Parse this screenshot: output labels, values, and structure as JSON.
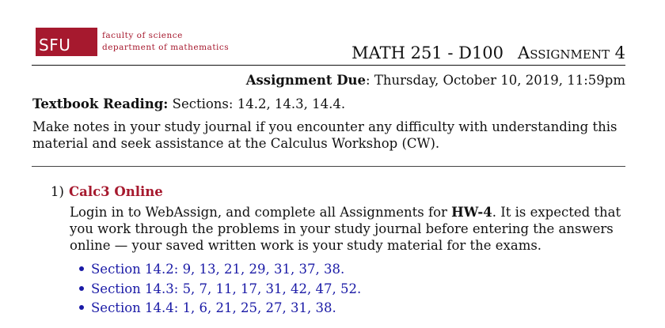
{
  "header": {
    "logo_text": "SFU",
    "logo_line1": "faculty of science",
    "logo_line2": "department of mathematics",
    "course": "MATH 251 - D100",
    "assignment": "Assignment 4"
  },
  "due": {
    "label": "Assignment Due",
    "value": ": Thursday, October 10, 2019, 11:59pm"
  },
  "reading": {
    "label": "Textbook Reading:",
    "value": " Sections: 14.2, 14.3, 14.4."
  },
  "notes": "Make notes in your study journal if you encounter any difficulty with understanding this material and seek assistance at the Calculus Workshop (CW).",
  "question": {
    "number": "1)",
    "title": "Calc3 Online",
    "body_pre": "Login in to WebAssign, and complete all Assignments for ",
    "body_bold": "HW-4",
    "body_post": ". It is expected that you work through the problems in your study journal before entering the answers online — your saved written work is your study material for the exams.",
    "items": [
      "Section 14.2: 9, 13, 21, 29, 31, 37, 38.",
      "Section 14.3: 5, 7, 11, 17, 31, 42, 47, 52.",
      "Section 14.4: 1, 6, 21, 25, 27, 31, 38."
    ]
  },
  "colors": {
    "sfu_red": "#a6192e",
    "link_blue": "#1a1aa6"
  }
}
